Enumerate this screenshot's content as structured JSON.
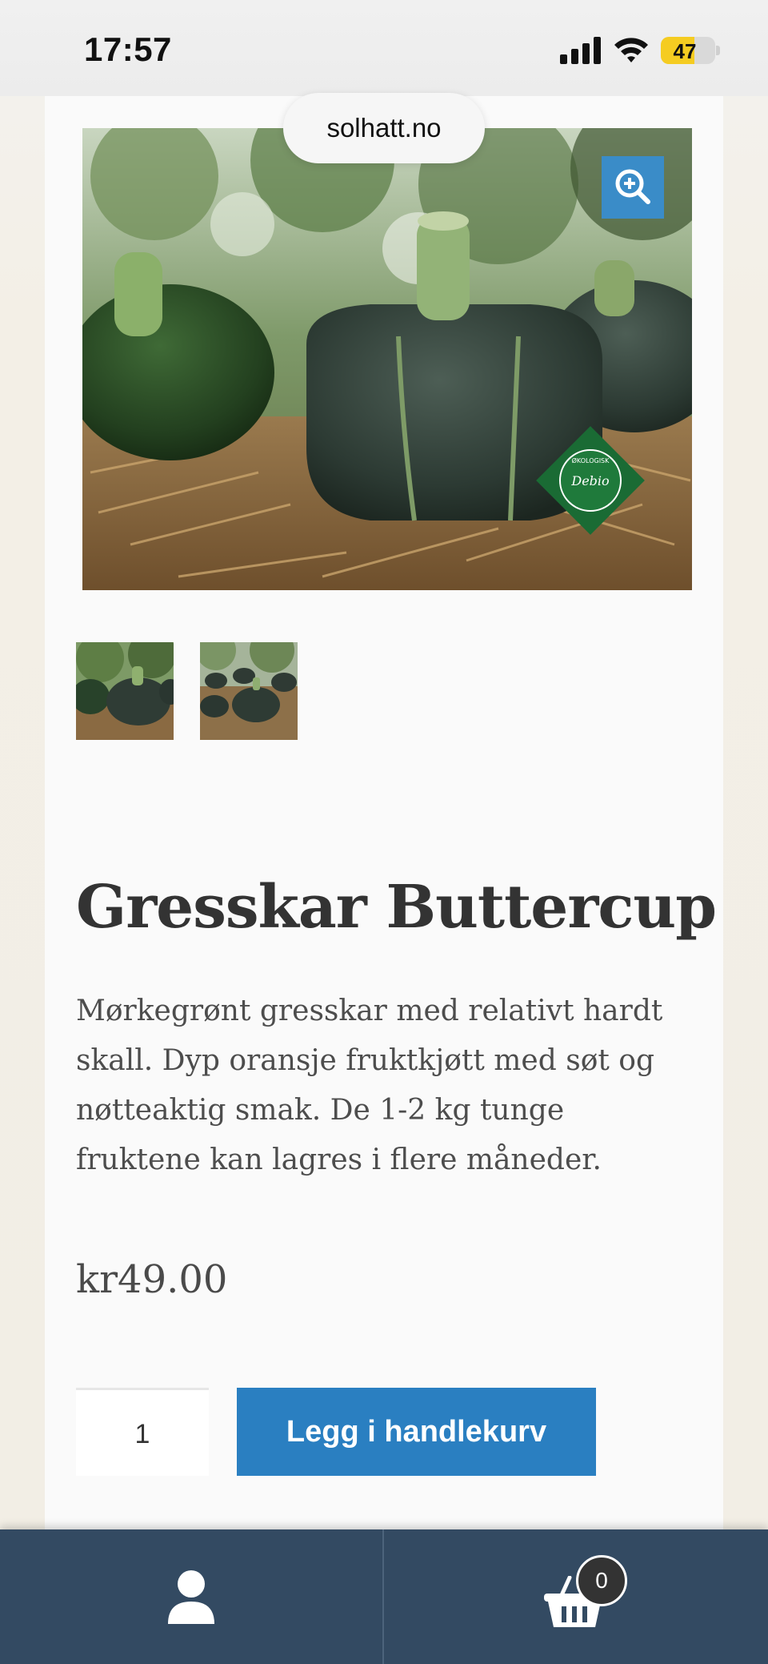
{
  "status_bar": {
    "time": "17:57",
    "battery_level": "47"
  },
  "browser": {
    "url": "solhatt.no"
  },
  "product": {
    "main_image_alt": "Gresskar Buttercup",
    "badge_text": "Debio",
    "badge_ring_text": "ØKOLOGISK",
    "title": "Gresskar Buttercup",
    "description": "Mørkegrønt gresskar med relativt hardt skall. Dyp oransje fruktkjøtt med søt og nøtteaktig smak. De 1-2 kg tunge fruktene kan lagres i flere måneder.",
    "price": "kr49.00",
    "quantity": "1",
    "add_to_cart_label": "Legg i handlekurv"
  },
  "bottom_nav": {
    "account_icon": "user-icon",
    "cart_icon": "basket-icon",
    "cart_count": "0"
  },
  "colors": {
    "accent": "#2a7fc1",
    "bottom_bar": "#334a62",
    "battery": "#f5cc21"
  }
}
